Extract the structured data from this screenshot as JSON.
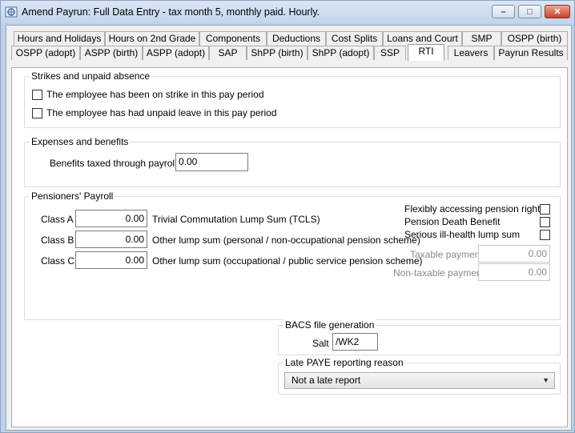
{
  "window": {
    "title": "Amend Payrun: Full Data Entry - tax month 5, monthly paid.  Hourly.",
    "buttons": {
      "minimize": "–",
      "maximize": "□",
      "close": "✕"
    }
  },
  "tabs": {
    "row1": [
      "Hours and Holidays",
      "Hours on 2nd Grade",
      "Components",
      "Deductions",
      "Cost Splits",
      "Loans and Court",
      "SMP",
      "OSPP (birth)"
    ],
    "row2": [
      "OSPP (adopt)",
      "ASPP (birth)",
      "ASPP (adopt)",
      "SAP",
      "ShPP (birth)",
      "ShPP (adopt)",
      "SSP",
      "RTI",
      "Leavers",
      "Payrun Results"
    ],
    "active": "RTI"
  },
  "strikes": {
    "title": "Strikes and unpaid absence",
    "strike_label": "The employee has been on strike in this pay period",
    "unpaid_label": "The employee has had unpaid leave in this pay period"
  },
  "expenses": {
    "title": "Expenses and benefits",
    "benefits_label": "Benefits taxed through payroll:",
    "benefits_value": "0.00"
  },
  "pensioners": {
    "title": "Pensioners' Payroll",
    "classes": [
      {
        "label": "Class A",
        "value": "0.00",
        "desc": "Trivial Commutation Lump Sum (TCLS)"
      },
      {
        "label": "Class B",
        "value": "0.00",
        "desc": "Other lump sum (personal / non-occupational pension scheme)"
      },
      {
        "label": "Class C",
        "value": "0.00",
        "desc": "Other lump sum (occupational / public service pension scheme)"
      }
    ],
    "flexibly_label": "Flexibly accessing pension rights",
    "death_label": "Pension Death Benefit",
    "illhealth_label": "Serious ill-health lump sum",
    "taxable_label": "Taxable payment",
    "taxable_value": "0.00",
    "nontaxable_label": "Non-taxable payment",
    "nontaxable_value": "0.00"
  },
  "bacs": {
    "title": "BACS file generation",
    "salt_label": "Salt",
    "salt_value": "/WK2"
  },
  "late_paye": {
    "title": "Late PAYE reporting reason",
    "selected": "Not a late report"
  }
}
